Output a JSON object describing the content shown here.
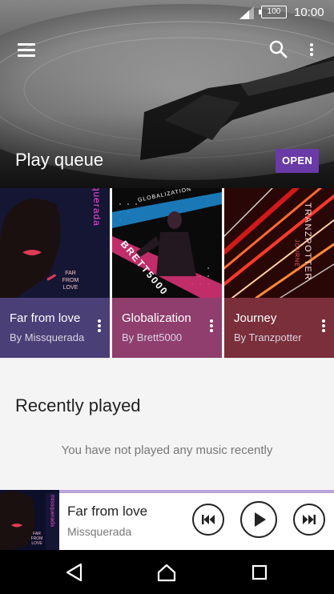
{
  "status_bar": {
    "time": "10:00",
    "battery_level": "100"
  },
  "toolbar": {
    "menu_icon": "hamburger-menu-icon",
    "search_icon": "search-icon",
    "more_icon": "more-vert-icon"
  },
  "header": {
    "title": "Play queue",
    "open_label": "OPEN"
  },
  "queue_cards": [
    {
      "title": "Far from love",
      "subtitle": "By Missquerada",
      "art_text": "missquerada",
      "art_caption": "FAR FROM LOVE",
      "color": "#4a3f76"
    },
    {
      "title": "Globalization",
      "subtitle": "By Brett5000",
      "art_text": "BRETT5000",
      "art_caption": "GLOBALIZATION",
      "color": "#8f3e6e"
    },
    {
      "title": "Journey",
      "subtitle": "By Tranzpotter",
      "art_text": "TRANZPOTTER",
      "art_caption": "JOURNEY",
      "color": "#7a2f3a"
    }
  ],
  "recently_played": {
    "title": "Recently played",
    "empty_message": "You have not played any music recently"
  },
  "now_playing": {
    "title": "Far from love",
    "artist": "Missquerada",
    "art_caption": "FAR FROM LOVE",
    "art_text": "missquerada"
  },
  "colors": {
    "accent": "#6a3aa6",
    "progress": "#b9a3d8"
  }
}
